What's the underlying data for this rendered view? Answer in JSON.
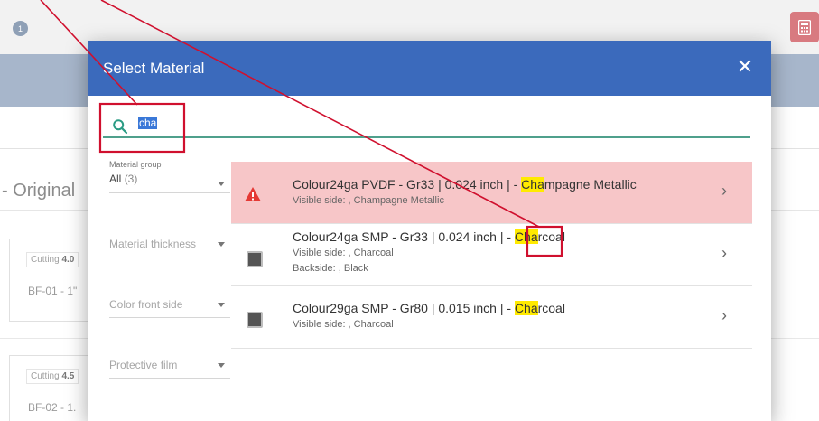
{
  "background": {
    "badge_count": "1",
    "section_title": "- Original",
    "cards": [
      {
        "cutting_label": "Cutting",
        "cutting_value": "4.0",
        "item_code": "BF-01 - 1\""
      },
      {
        "cutting_label": "Cutting",
        "cutting_value": "4.5",
        "item_code": "BF-02 - 1."
      }
    ]
  },
  "modal": {
    "title": "Select Material",
    "close_label": "✕",
    "search": {
      "value": "cha"
    },
    "filters": {
      "material_group": {
        "label": "Material group",
        "value": "All",
        "count": "(3)"
      },
      "material_thickness": {
        "placeholder": "Material thickness"
      },
      "color_front_side": {
        "placeholder": "Color front side"
      },
      "protective_film": {
        "placeholder": "Protective film"
      }
    },
    "results": [
      {
        "title_pre": "Colour24ga PVDF - Gr33 | 0.024 inch | - ",
        "title_hl": "Cha",
        "title_post": "mpagne Metallic",
        "visible_side": "Visible side: , Champagne Metallic",
        "status": "warning"
      },
      {
        "title_pre": "Colour24ga SMP - Gr33 | 0.024 inch | - ",
        "title_hl": "Cha",
        "title_post": "rcoal",
        "visible_side": "Visible side: , Charcoal",
        "backside": "Backside: , Black",
        "swatch_color": "#555555"
      },
      {
        "title_pre": "Colour29ga SMP - Gr80 | 0.015 inch | - ",
        "title_hl": "Cha",
        "title_post": "rcoal",
        "visible_side": "Visible side: , Charcoal",
        "swatch_color": "#555555"
      }
    ]
  },
  "colors": {
    "header_blue": "#3b6abc",
    "search_underline": "#4fa08c",
    "warning_row": "#f7c6c8",
    "warning_icon": "#e53935",
    "highlight": "#ffea00",
    "annotation_red": "#d0102e"
  }
}
